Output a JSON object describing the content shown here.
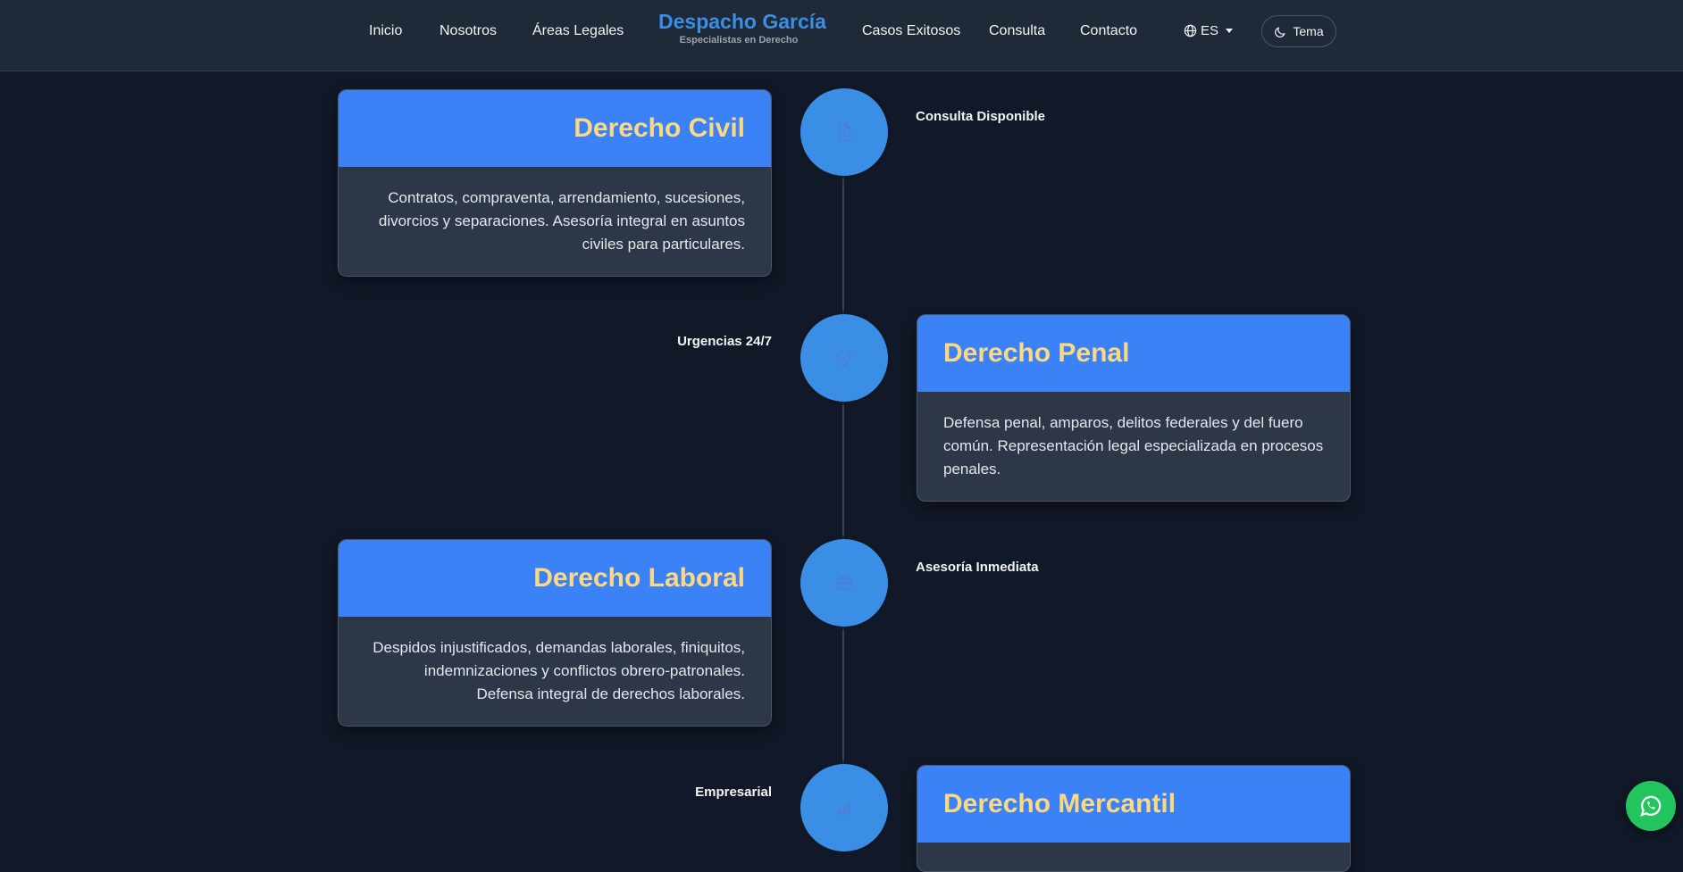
{
  "nav": {
    "links": [
      "Inicio",
      "Nosotros",
      "Áreas Legales",
      "Casos Exitosos",
      "Consulta",
      "Contacto"
    ],
    "brand_title": "Despacho García",
    "brand_subtitle": "Especialistas en Derecho",
    "language": "ES",
    "theme_label": "Tema"
  },
  "areas": [
    {
      "title": "Derecho Civil",
      "description": "Contratos, compraventa, arrendamiento, sucesiones, divorcios y separaciones. Asesoría integral en asuntos civiles para particulares.",
      "tag": "Consulta Disponible",
      "icon": "document-icon"
    },
    {
      "title": "Derecho Penal",
      "description": "Defensa penal, amparos, delitos federales y del fuero común. Representación legal especializada en procesos penales.",
      "tag": "Urgencias 24/7",
      "icon": "shield-icon"
    },
    {
      "title": "Derecho Laboral",
      "description": "Despidos injustificados, demandas laborales, finiquitos, indemnizaciones y conflictos obrero-patronales. Defensa integral de derechos laborales.",
      "tag": "Asesoría Inmediata",
      "icon": "briefcase-icon"
    },
    {
      "title": "Derecho Mercantil",
      "tag": "Empresarial",
      "icon": "building-icon"
    }
  ],
  "colors": {
    "background": "#111827",
    "accent": "#3b82f6",
    "title_gold": "#fcd881",
    "whatsapp": "#22c55e"
  }
}
